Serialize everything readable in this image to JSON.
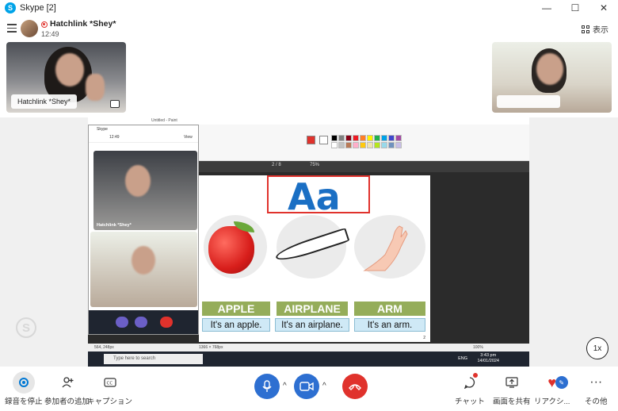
{
  "window": {
    "title": "Skype [2]",
    "minimize": "—",
    "maximize": "☐",
    "close": "✕"
  },
  "call": {
    "name": "Hatchlink *Shey*",
    "time": "12:49",
    "view_label": "表示"
  },
  "participants": [
    {
      "label": "Hatchlink *Shey*"
    },
    {
      "label": ""
    }
  ],
  "share": {
    "paint_title": "Untitled - Paint",
    "pdf_page": "2 / 8",
    "pdf_zoom": "75%",
    "slide": {
      "letters": "Aa",
      "items": [
        {
          "word": "APPLE",
          "phrase": "It's an apple."
        },
        {
          "word": "AIRPLANE",
          "phrase": "It's an airplane."
        },
        {
          "word": "ARM",
          "phrase": "It's an arm."
        }
      ],
      "page_number": "2"
    },
    "status_left": "564, 248px",
    "status_mid": "1366 × 768px",
    "status_zoom": "100%",
    "taskbar_search": "Type here to search",
    "taskbar_lang": "ENG",
    "taskbar_time": "3:43 pm",
    "taskbar_date": "14/01/2024",
    "mini_skype": {
      "title": "Skype",
      "time": "12:49",
      "view": "View",
      "label": "Hatchlink *Shey*"
    }
  },
  "zoom_label": "1x",
  "toolbar": {
    "stop_recording": "録音を停止",
    "add_participant": "参加者の追加",
    "captions": "キャプション",
    "chat": "チャット",
    "share_screen": "画面を共有",
    "reactions": "リアクシ...",
    "more": "その他"
  },
  "colors": {
    "accent": "#0078d4",
    "hangup": "#e0322c",
    "brand": "#00a3e8"
  }
}
